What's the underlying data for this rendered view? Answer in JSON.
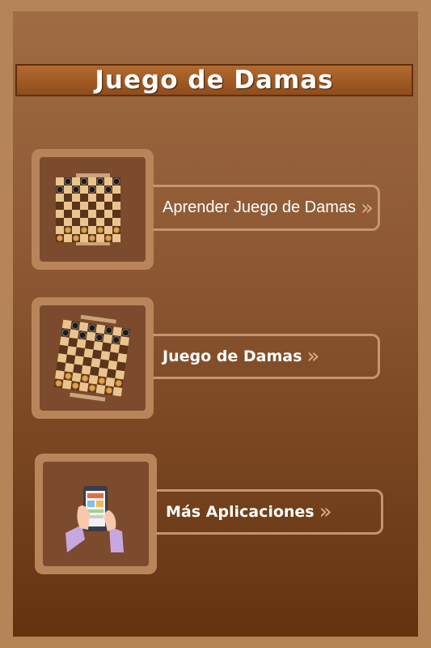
{
  "header": {
    "title": "Juego de Damas"
  },
  "menu": [
    {
      "label": "Aprender Juego de Damas",
      "icon": "checkerboard-icon"
    },
    {
      "label": "Juego de Damas",
      "icon": "tilted-checkerboard-icon"
    },
    {
      "label": "Más Aplicaciones",
      "icon": "phone-in-hands-icon"
    }
  ],
  "chevron": "»",
  "colors": {
    "frame": "#b48657",
    "title_bar": "#a35d27",
    "tile": "#7c4a2c",
    "border": "#c4956e"
  }
}
